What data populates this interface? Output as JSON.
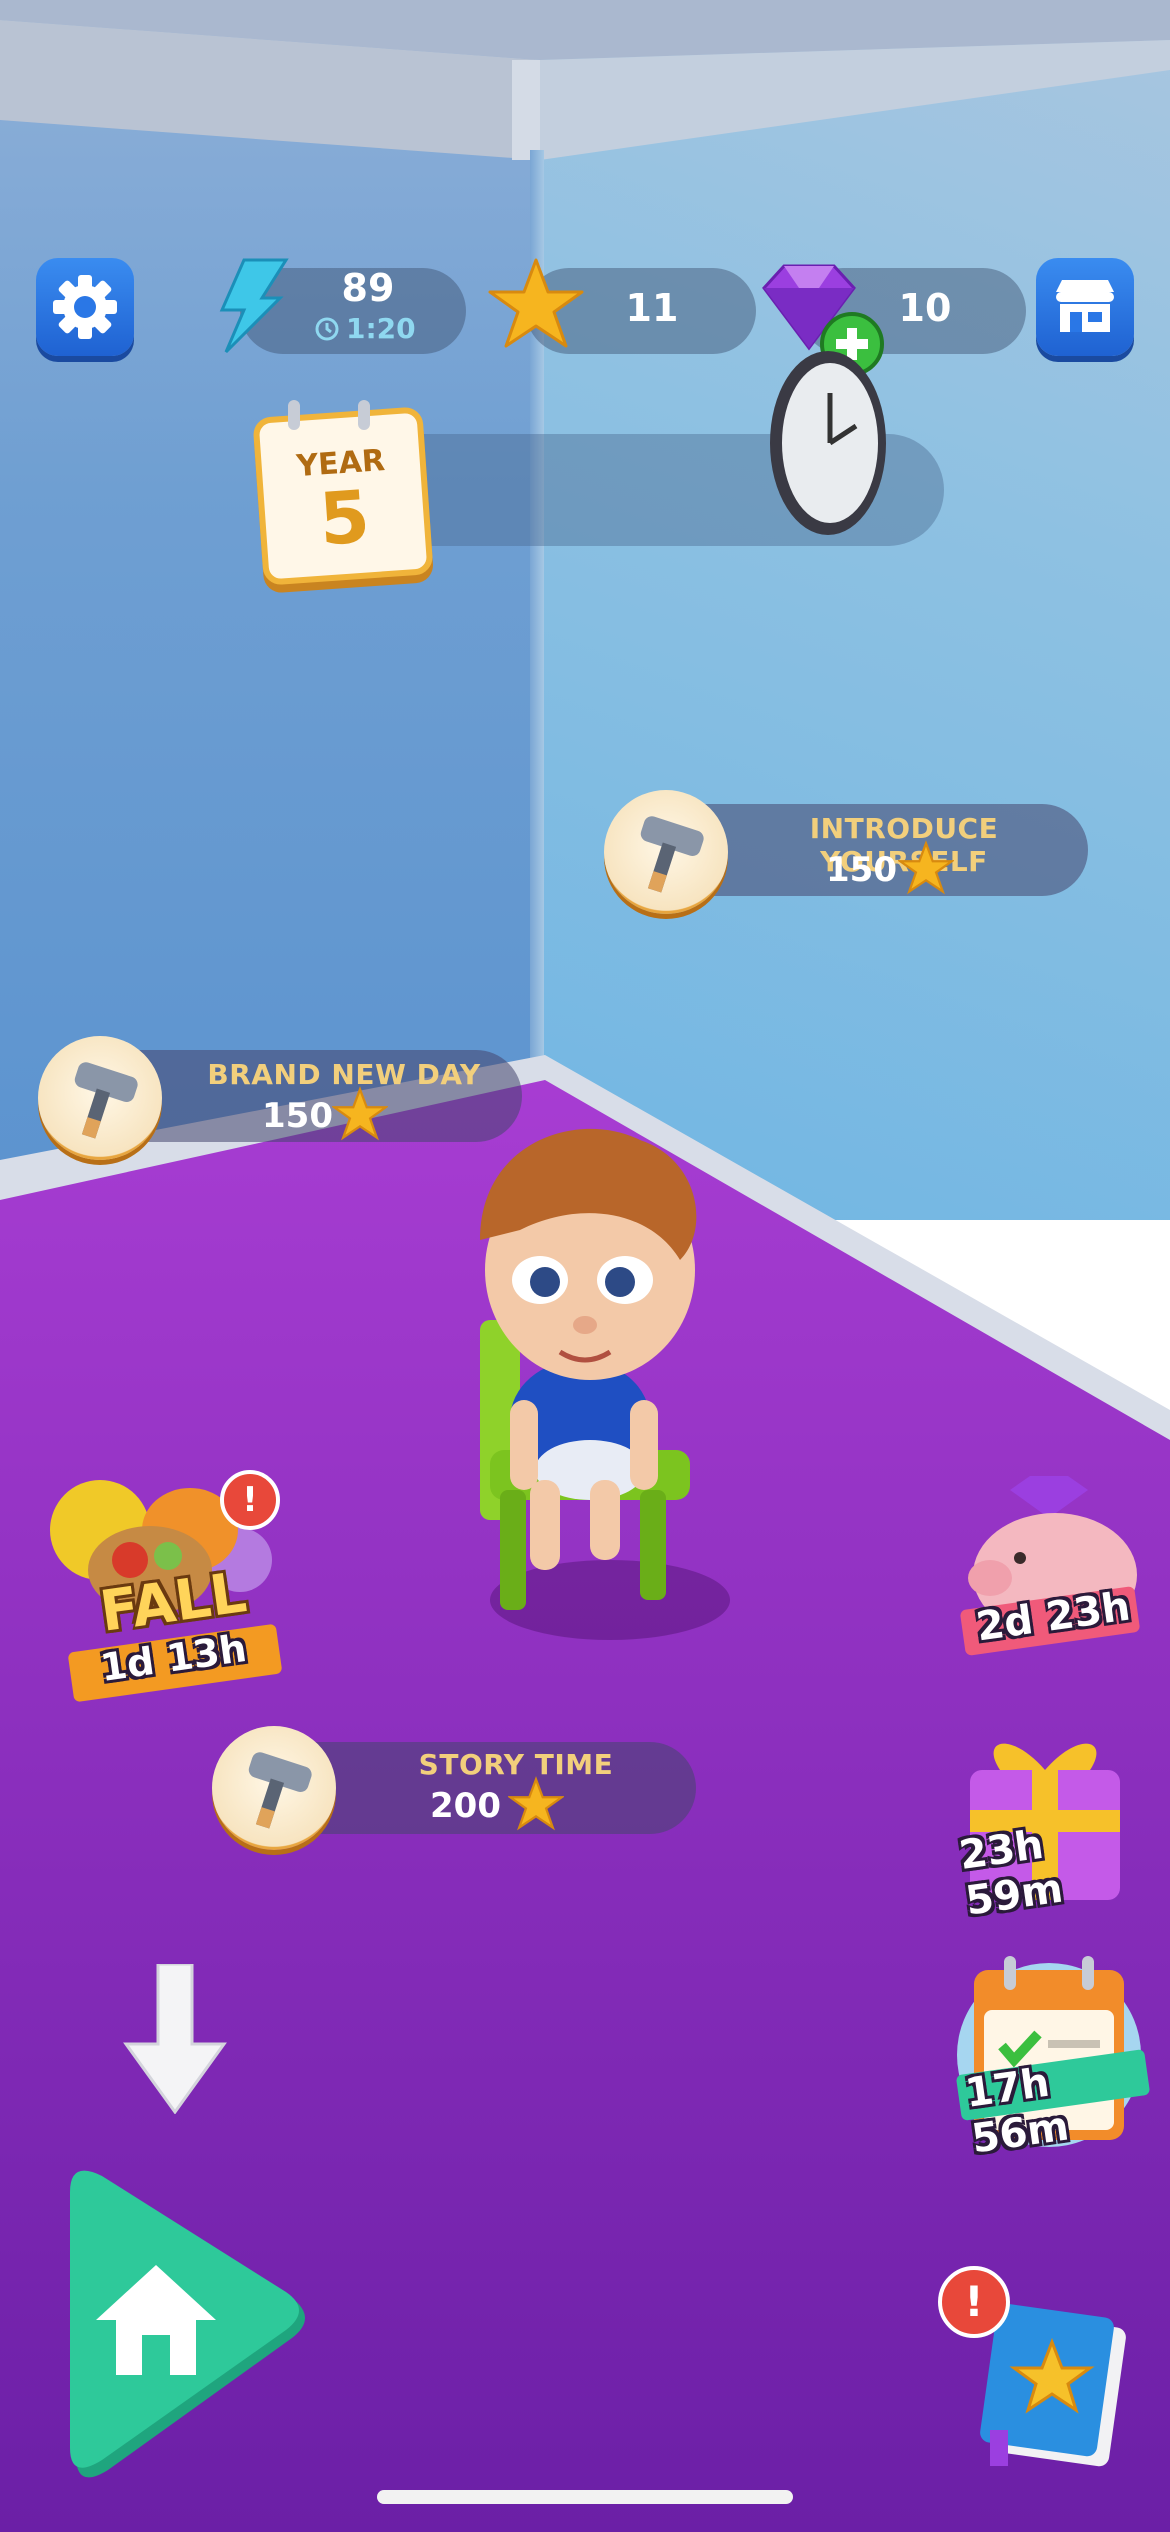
{
  "hud": {
    "energy_value": "89",
    "energy_timer": "1:20",
    "stars_value": "11",
    "gems_value": "10"
  },
  "year_badge": {
    "label": "YEAR",
    "number": "5"
  },
  "quests": [
    {
      "title": "INTRODUCE YOURSELF",
      "reward": "150"
    },
    {
      "title": "BRAND NEW DAY",
      "reward": "150"
    },
    {
      "title": "STORY TIME",
      "reward": "200"
    }
  ],
  "events": {
    "fall_label": "FALL",
    "fall_timer": "1d 13h",
    "piggy_timer": "2d 23h",
    "gift_timer": "23h 59m",
    "calendar_timer": "17h 56m"
  },
  "colors": {
    "floor": "#8a2fc0",
    "accent_blue": "#2a77e6",
    "home_green": "#2ec99a",
    "star_gold": "#f6b51f"
  },
  "icons": [
    "settings-gear-icon",
    "energy-bolt-icon",
    "clock-icon",
    "star-icon",
    "gem-icon",
    "plus-icon",
    "shop-icon",
    "hammer-icon",
    "home-icon",
    "down-arrow-icon",
    "star-book-icon",
    "alert-icon"
  ]
}
